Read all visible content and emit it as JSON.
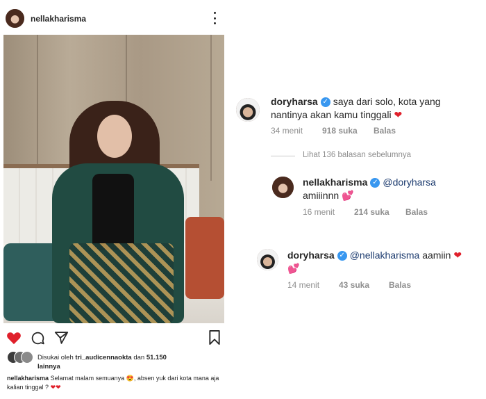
{
  "post": {
    "username": "nellakharisma",
    "likes": {
      "prefix": "Disukai oleh",
      "user": "tri_audicennaokta",
      "conj": "dan",
      "count": "51.150",
      "suffix": "lainnya"
    },
    "caption": {
      "username": "nellakharisma",
      "text": "Selamat malam semuanya 😍, absen yuk dari kota mana aja kalian tinggal ?",
      "hearts": "❤❤"
    },
    "liked": true
  },
  "comments": [
    {
      "username": "doryharsa",
      "text_line1": "saya dari solo, kota yang",
      "text_line2": "nantinya akan kamu tinggali",
      "emoji": "❤",
      "time": "34 menit",
      "likes": "918 suka",
      "reply": "Balas"
    },
    {
      "username": "nellakharisma",
      "mention": "@doryharsa",
      "text": "amiiinnn",
      "emoji": "💕",
      "time": "16 menit",
      "likes": "214 suka",
      "reply": "Balas"
    },
    {
      "username": "doryharsa",
      "mention": "@nellakharisma",
      "text": "aamiin",
      "emoji_after": "❤",
      "emoji": "💕",
      "time": "14 menit",
      "likes": "43 suka",
      "reply": "Balas"
    }
  ],
  "view_replies": "Lihat 136 balasan sebelumnya",
  "colors": {
    "heart": "#e0202b",
    "verified": "#3897f0",
    "meta": "#8e8e8e"
  },
  "icons": [
    "heart-icon",
    "comment-icon",
    "share-icon",
    "bookmark-icon",
    "verified-icon",
    "more-icon"
  ]
}
